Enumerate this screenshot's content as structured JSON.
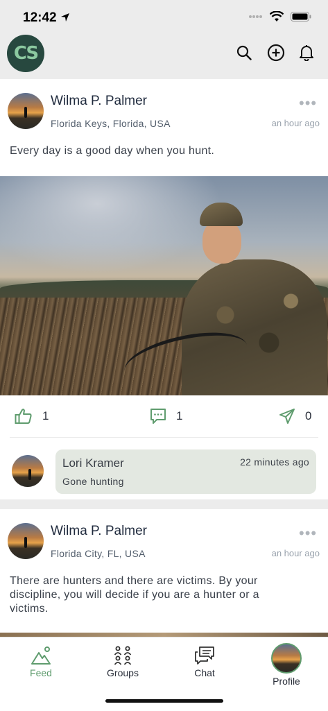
{
  "status": {
    "time": "12:42"
  },
  "colors": {
    "accent": "#5f9c6e",
    "logo_bg": "#27483f",
    "comment_bg": "#e3e8e1"
  },
  "header": {
    "logo_text": "CS",
    "icons": [
      "search-icon",
      "plus-circle-icon",
      "bell-icon"
    ]
  },
  "posts": [
    {
      "author": "Wilma P. Palmer",
      "location": "Florida Keys, Florida, USA",
      "time": "an hour ago",
      "text": "Every day is a good day when you hunt.",
      "likes": "1",
      "comments": "1",
      "shares": "0",
      "comment": {
        "author": "Lori Kramer",
        "time": "22 minutes ago",
        "text": "Gone hunting"
      }
    },
    {
      "author": "Wilma P. Palmer",
      "location": "Florida City, FL, USA",
      "time": "an hour ago",
      "text": "There are hunters and there are victims. By your discipline, you will decide if you are a hunter or a victims."
    }
  ],
  "tabs": [
    {
      "label": "Feed",
      "icon": "mountain-icon",
      "active": true
    },
    {
      "label": "Groups",
      "icon": "groups-icon"
    },
    {
      "label": "Chat",
      "icon": "chat-icon"
    },
    {
      "label": "Profile",
      "icon": "profile-avatar"
    }
  ]
}
